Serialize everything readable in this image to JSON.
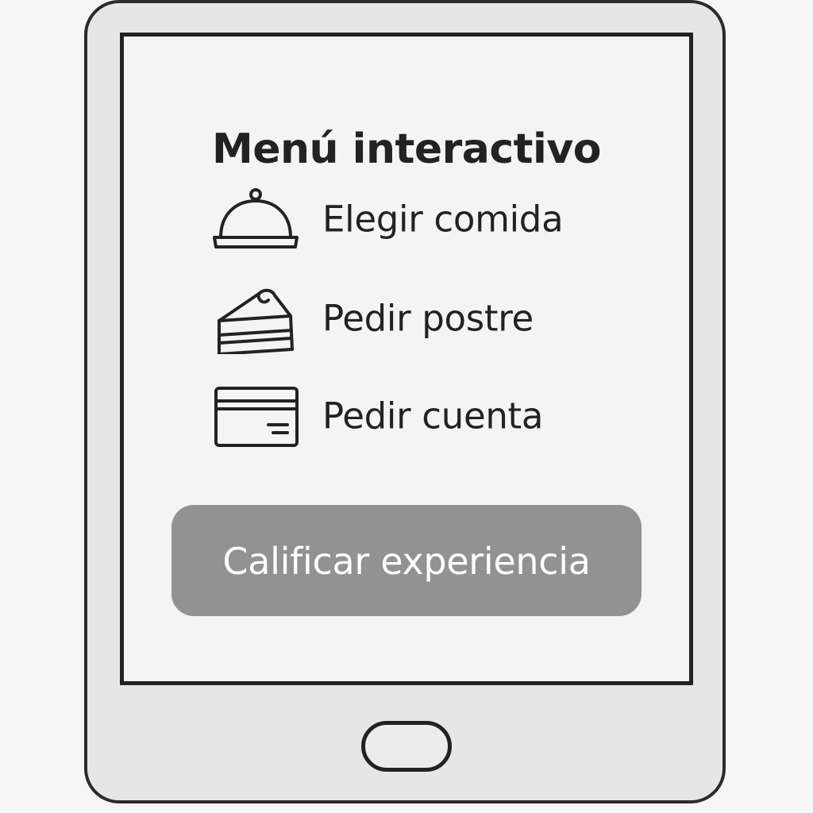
{
  "screen": {
    "title": "Menú interactivo",
    "menu_items": [
      {
        "label": "Elegir comida",
        "icon": "cloche-icon"
      },
      {
        "label": "Pedir postre",
        "icon": "cake-slice-icon"
      },
      {
        "label": "Pedir cuenta",
        "icon": "credit-card-icon"
      }
    ],
    "rate_button_label": "Calificar experiencia"
  },
  "colors": {
    "button_bg": "#929292",
    "outline": "#222222",
    "device_body": "#e6e6e6",
    "screen_bg": "#f4f4f4"
  }
}
